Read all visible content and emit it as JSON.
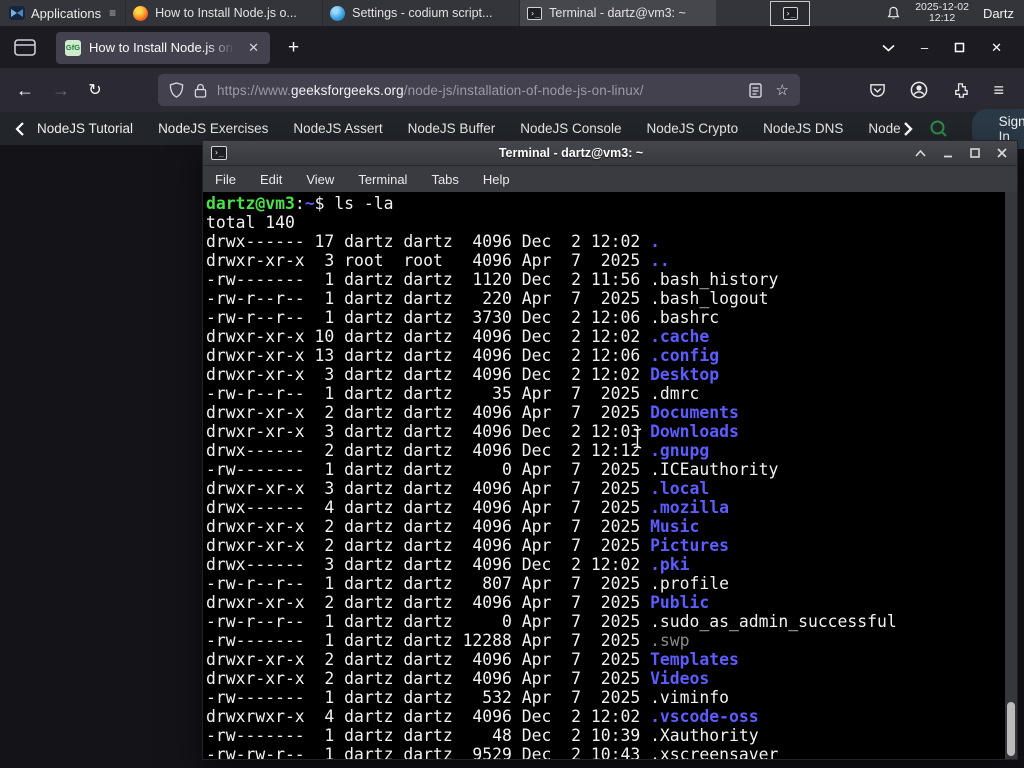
{
  "taskbar": {
    "applications": "Applications",
    "windows": [
      {
        "icon": "firefox",
        "title": "How to Install Node.js o...",
        "active": false
      },
      {
        "icon": "vscodium",
        "title": "Settings - codium script...",
        "active": false
      },
      {
        "icon": "terminal",
        "title": "Terminal - dartz@vm3: ~",
        "active": true
      }
    ],
    "clock": {
      "date": "2025-12-02",
      "time": "12:12"
    },
    "user": "Dartz"
  },
  "browser": {
    "tab_title": "How to Install Node.js on",
    "favicon_text": "GfG",
    "url_prefix": "https://www.",
    "url_domain": "geeksforgeeks.org",
    "url_path": "/node-js/installation-of-node-js-on-linux/",
    "site_nav": {
      "items": [
        "NodeJS Tutorial",
        "NodeJS Exercises",
        "NodeJS Assert",
        "NodeJS Buffer",
        "NodeJS Console",
        "NodeJS Crypto",
        "NodeJS DNS",
        "Node"
      ],
      "sign_in": "Sign In"
    }
  },
  "terminal": {
    "title": "Terminal - dartz@vm3: ~",
    "menus": [
      "File",
      "Edit",
      "View",
      "Terminal",
      "Tabs",
      "Help"
    ],
    "prompt": {
      "user_host": "dartz@vm3",
      "colon": ":",
      "path": "~",
      "dollar": "$ ",
      "command": "ls -la"
    },
    "total_line": "total 140",
    "listing": [
      {
        "pre": "drwx------ 17 dartz dartz  4096 Dec  2 12:02 ",
        "name": ".",
        "type": "dir"
      },
      {
        "pre": "drwxr-xr-x  3 root  root   4096 Apr  7  2025 ",
        "name": "..",
        "type": "dir"
      },
      {
        "pre": "-rw-------  1 dartz dartz  1120 Dec  2 11:56 ",
        "name": ".bash_history",
        "type": "file"
      },
      {
        "pre": "-rw-r--r--  1 dartz dartz   220 Apr  7  2025 ",
        "name": ".bash_logout",
        "type": "file"
      },
      {
        "pre": "-rw-r--r--  1 dartz dartz  3730 Dec  2 12:06 ",
        "name": ".bashrc",
        "type": "file"
      },
      {
        "pre": "drwxr-xr-x 10 dartz dartz  4096 Dec  2 12:02 ",
        "name": ".cache",
        "type": "dir"
      },
      {
        "pre": "drwxr-xr-x 13 dartz dartz  4096 Dec  2 12:06 ",
        "name": ".config",
        "type": "dir"
      },
      {
        "pre": "drwxr-xr-x  3 dartz dartz  4096 Dec  2 12:02 ",
        "name": "Desktop",
        "type": "dir"
      },
      {
        "pre": "-rw-r--r--  1 dartz dartz    35 Apr  7  2025 ",
        "name": ".dmrc",
        "type": "file"
      },
      {
        "pre": "drwxr-xr-x  2 dartz dartz  4096 Apr  7  2025 ",
        "name": "Documents",
        "type": "dir"
      },
      {
        "pre": "drwxr-xr-x  3 dartz dartz  4096 Dec  2 12:03 ",
        "name": "Downloads",
        "type": "dir"
      },
      {
        "pre": "drwx------  2 dartz dartz  4096 Dec  2 12:12 ",
        "name": ".gnupg",
        "type": "dir"
      },
      {
        "pre": "-rw-------  1 dartz dartz     0 Apr  7  2025 ",
        "name": ".ICEauthority",
        "type": "file"
      },
      {
        "pre": "drwxr-xr-x  3 dartz dartz  4096 Apr  7  2025 ",
        "name": ".local",
        "type": "dir"
      },
      {
        "pre": "drwx------  4 dartz dartz  4096 Apr  7  2025 ",
        "name": ".mozilla",
        "type": "dir"
      },
      {
        "pre": "drwxr-xr-x  2 dartz dartz  4096 Apr  7  2025 ",
        "name": "Music",
        "type": "dir"
      },
      {
        "pre": "drwxr-xr-x  2 dartz dartz  4096 Apr  7  2025 ",
        "name": "Pictures",
        "type": "dir"
      },
      {
        "pre": "drwx------  3 dartz dartz  4096 Dec  2 12:02 ",
        "name": ".pki",
        "type": "dir"
      },
      {
        "pre": "-rw-r--r--  1 dartz dartz   807 Apr  7  2025 ",
        "name": ".profile",
        "type": "file"
      },
      {
        "pre": "drwxr-xr-x  2 dartz dartz  4096 Apr  7  2025 ",
        "name": "Public",
        "type": "dir"
      },
      {
        "pre": "-rw-r--r--  1 dartz dartz     0 Apr  7  2025 ",
        "name": ".sudo_as_admin_successful",
        "type": "file"
      },
      {
        "pre": "-rw-------  1 dartz dartz 12288 Apr  7  2025 ",
        "name": ".swp",
        "type": "dim"
      },
      {
        "pre": "drwxr-xr-x  2 dartz dartz  4096 Apr  7  2025 ",
        "name": "Templates",
        "type": "dir"
      },
      {
        "pre": "drwxr-xr-x  2 dartz dartz  4096 Apr  7  2025 ",
        "name": "Videos",
        "type": "dir"
      },
      {
        "pre": "-rw-------  1 dartz dartz   532 Apr  7  2025 ",
        "name": ".viminfo",
        "type": "file"
      },
      {
        "pre": "drwxrwxr-x  4 dartz dartz  4096 Dec  2 12:02 ",
        "name": ".vscode-oss",
        "type": "dir"
      },
      {
        "pre": "-rw-------  1 dartz dartz    48 Dec  2 10:39 ",
        "name": ".Xauthority",
        "type": "file"
      },
      {
        "pre": "-rw-rw-r--  1 dartz dartz  9529 Dec  2 10:43 ",
        "name": ".xscreensaver",
        "type": "file"
      }
    ]
  },
  "icons": {
    "new_tab": "+",
    "close": "✕",
    "minimize": "–",
    "back": "←",
    "forward": "→",
    "reload": "↻",
    "hamburger": "≡",
    "star": "☆",
    "apps_menu": "≡",
    "term_glyph": "›_"
  },
  "colors": {
    "prompt_green": "#4ae24a",
    "dir_blue": "#5c5cff",
    "dim_gray": "#8a8a8a",
    "gfg_green": "#2f8d46",
    "terminal_bg": "#000000",
    "firefox_toolbar": "#2b2a33"
  }
}
